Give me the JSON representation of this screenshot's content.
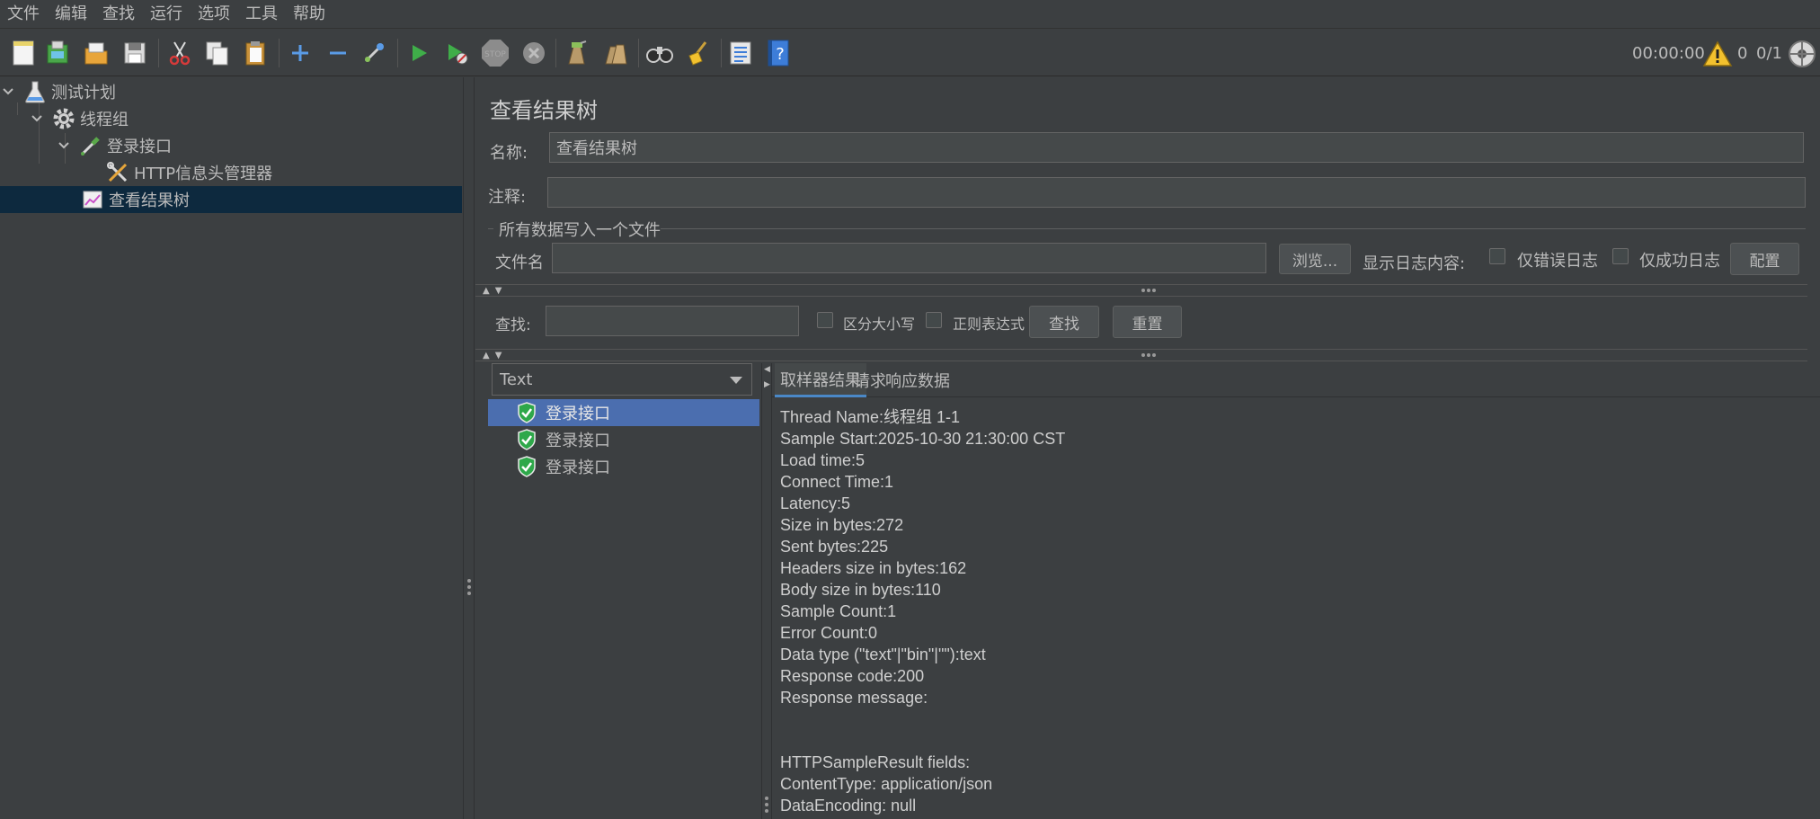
{
  "menu": [
    "文件",
    "编辑",
    "查找",
    "运行",
    "选项",
    "工具",
    "帮助"
  ],
  "toolbar": {
    "timer": "00:00:00",
    "warnings": "0",
    "threads": "0/1",
    "colors": {
      "run": "#3fae49",
      "warn": "#f2c12e",
      "help": "#3d7dd8"
    }
  },
  "tree": {
    "items": [
      {
        "label": "测试计划",
        "icon": "flask-icon"
      },
      {
        "label": "线程组",
        "icon": "gear-icon"
      },
      {
        "label": "登录接口",
        "icon": "pipette-icon"
      },
      {
        "label": "HTTP信息头管理器",
        "icon": "tools-icon"
      },
      {
        "label": "查看结果树",
        "icon": "chart-icon"
      }
    ]
  },
  "panel": {
    "title": "查看结果树",
    "name_label": "名称:",
    "name_value": "查看结果树",
    "comment_label": "注释:",
    "comment_value": "",
    "file_group": "所有数据写入一个文件",
    "filename_label": "文件名",
    "filename_value": "",
    "browse_button": "浏览...",
    "log_label": "显示日志内容:",
    "errors_only": "仅错误日志",
    "success_only": "仅成功日志",
    "configure_button": "配置",
    "search_label": "查找:",
    "search_value": "",
    "case_sensitive": "区分大小写",
    "regex": "正则表达式",
    "find_button": "查找",
    "reset_button": "重置"
  },
  "results": {
    "renderer": "Text",
    "samples": [
      "登录接口",
      "登录接口",
      "登录接口"
    ],
    "tabs": [
      "取样器结果",
      "请求",
      "响应数据"
    ],
    "detail_lines": [
      "Thread Name:线程组 1-1",
      "Sample Start:2025-10-30 21:30:00 CST",
      "Load time:5",
      "Connect Time:1",
      "Latency:5",
      "Size in bytes:272",
      "Sent bytes:225",
      "Headers size in bytes:162",
      "Body size in bytes:110",
      "Sample Count:1",
      "Error Count:0",
      "Data type (\"text\"|\"bin\"|\"\"):text",
      "Response code:200",
      "Response message:",
      "",
      "",
      "HTTPSampleResult fields:",
      "ContentType: application/json",
      "DataEncoding: null"
    ]
  }
}
